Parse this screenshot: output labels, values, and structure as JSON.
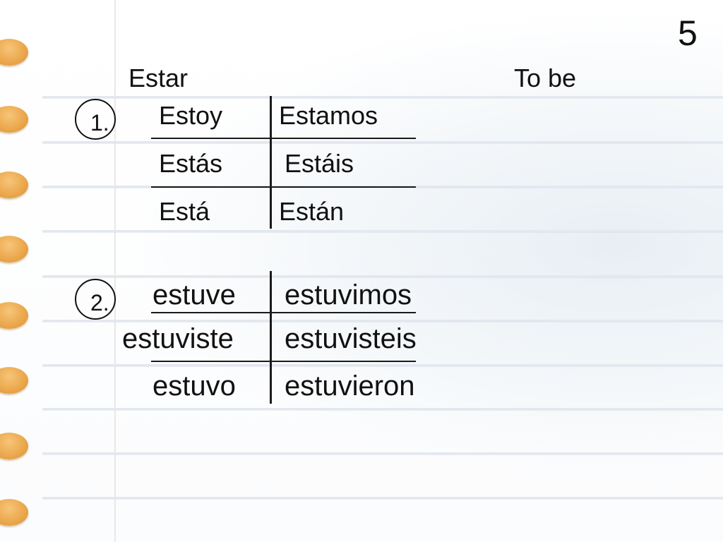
{
  "page_number": "5",
  "title_left": "Estar",
  "title_right": "To be",
  "section1": {
    "marker": "1.",
    "rows": [
      {
        "left": "Estoy",
        "right": "Estamos"
      },
      {
        "left": "Estás",
        "right": "Estáis"
      },
      {
        "left": "Está",
        "right": "Están"
      }
    ]
  },
  "section2": {
    "marker": "2.",
    "rows": [
      {
        "left": "estuve",
        "right": "estuvimos"
      },
      {
        "left": "estuviste",
        "right": "estuvisteis"
      },
      {
        "left": "estuvo",
        "right": "estuvieron"
      }
    ]
  },
  "colors": {
    "binder_hole": "#eaa64a",
    "rule_line": "#e3e8ef",
    "text": "#111111"
  },
  "icons": [
    "binder-hole-icon"
  ]
}
